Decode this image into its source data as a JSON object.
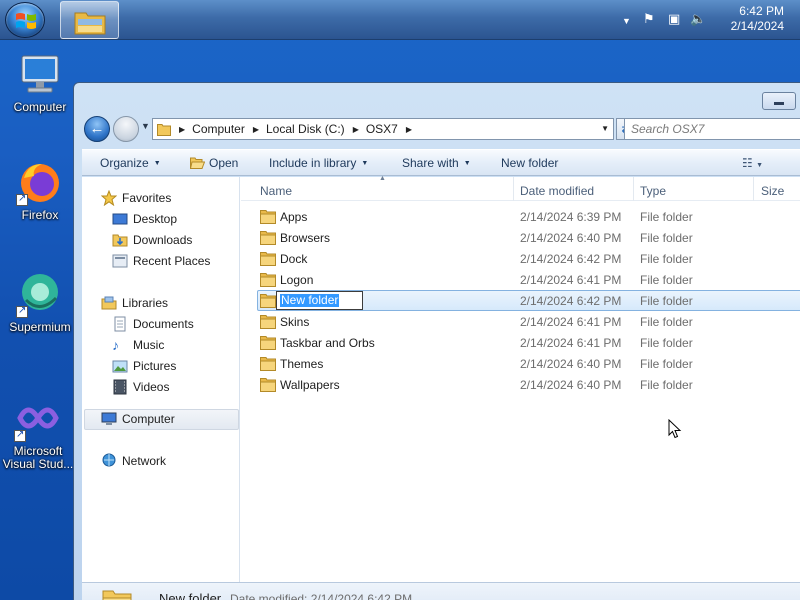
{
  "taskbar": {
    "clock_time": "6:42 PM",
    "clock_date": "2/14/2024",
    "tray_icons": [
      "chevron-up-icon",
      "flag-icon",
      "network-icon",
      "volume-muted-icon"
    ]
  },
  "desktop": {
    "icons": [
      {
        "label": "Computer",
        "icon": "computer-icon"
      },
      {
        "label": "Firefox",
        "icon": "firefox-icon"
      },
      {
        "label": "Supermium",
        "icon": "supermium-icon"
      },
      {
        "label": "Microsoft Visual Stud...",
        "icon": "visual-studio-icon"
      }
    ]
  },
  "window": {
    "address": {
      "crumbs": [
        "Computer",
        "Local Disk (C:)",
        "OSX7"
      ]
    },
    "search_placeholder": "Search OSX7",
    "toolbar": {
      "organize": "Organize",
      "open": "Open",
      "include_in_library": "Include in library",
      "share_with": "Share with",
      "new_folder": "New folder"
    },
    "nav": {
      "favorites": "Favorites",
      "desktop": "Desktop",
      "downloads": "Downloads",
      "recent_places": "Recent Places",
      "libraries": "Libraries",
      "documents": "Documents",
      "music": "Music",
      "pictures": "Pictures",
      "videos": "Videos",
      "computer": "Computer",
      "network": "Network"
    },
    "columns": {
      "name": "Name",
      "date_modified": "Date modified",
      "type": "Type",
      "size": "Size"
    },
    "files": [
      {
        "name": "Apps",
        "date": "2/14/2024 6:39 PM",
        "type": "File folder"
      },
      {
        "name": "Browsers",
        "date": "2/14/2024 6:40 PM",
        "type": "File folder"
      },
      {
        "name": "Dock",
        "date": "2/14/2024 6:42 PM",
        "type": "File folder"
      },
      {
        "name": "Logon",
        "date": "2/14/2024 6:41 PM",
        "type": "File folder"
      },
      {
        "name": "New folder",
        "date": "2/14/2024 6:42 PM",
        "type": "File folder",
        "selected": true,
        "renaming": true
      },
      {
        "name": "Skins",
        "date": "2/14/2024 6:41 PM",
        "type": "File folder"
      },
      {
        "name": "Taskbar and Orbs",
        "date": "2/14/2024 6:41 PM",
        "type": "File folder"
      },
      {
        "name": "Themes",
        "date": "2/14/2024 6:40 PM",
        "type": "File folder"
      },
      {
        "name": "Wallpapers",
        "date": "2/14/2024 6:40 PM",
        "type": "File folder"
      }
    ],
    "details_pane": {
      "name": "New folder",
      "modified": "Date modified: 2/14/2024 6:42 PM"
    }
  },
  "colors": {
    "desktop_blue": "#1a5ec2",
    "selection_blue": "#3399ff",
    "folder_yellow": "#f2c85b"
  }
}
